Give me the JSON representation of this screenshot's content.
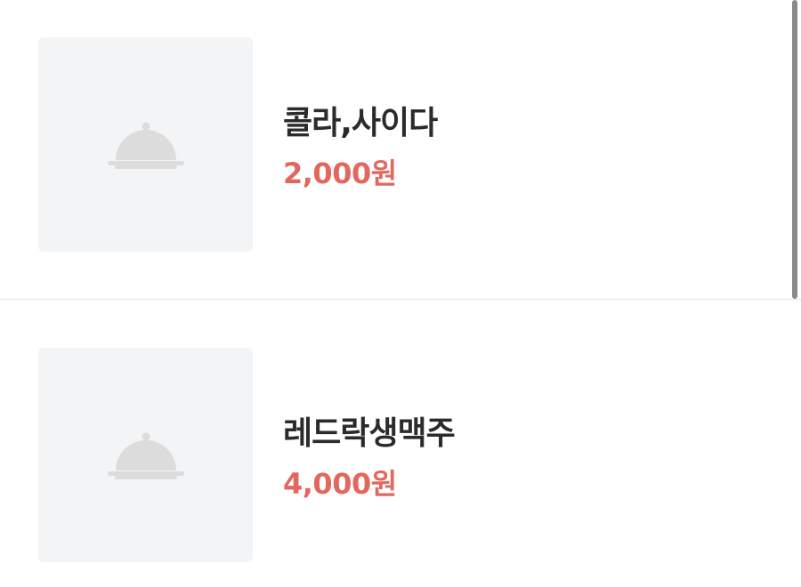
{
  "menu": {
    "items": [
      {
        "name": "콜라,사이다",
        "price": "2,000원",
        "image_icon": "food-cloche-icon"
      },
      {
        "name": "레드락생맥주",
        "price": "4,000원",
        "image_icon": "food-cloche-icon"
      }
    ]
  },
  "colors": {
    "price": "#e2685f",
    "name": "#2b2b2b",
    "placeholder_bg": "#f3f4f6",
    "icon": "#dcdcdc"
  }
}
